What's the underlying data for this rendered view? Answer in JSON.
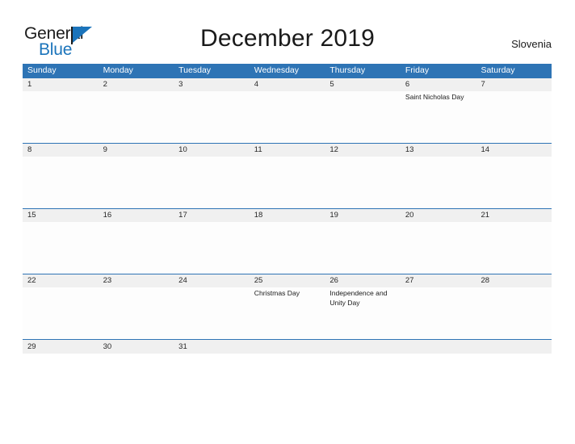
{
  "brand": {
    "name_part1": "General",
    "name_part2": "Blue",
    "flag_icon": "flag-triangle-icon"
  },
  "header": {
    "title": "December 2019",
    "country": "Slovenia"
  },
  "theme": {
    "header_blue": "#2e74b5",
    "logo_blue": "#1b74bb",
    "number_band": "#f0f0f0",
    "cell_bg": "#fdfdfd",
    "text": "#1a1a1a"
  },
  "calendar": {
    "weekdays": [
      "Sunday",
      "Monday",
      "Tuesday",
      "Wednesday",
      "Thursday",
      "Friday",
      "Saturday"
    ],
    "weeks": [
      {
        "height": "tall",
        "days": [
          {
            "num": "1",
            "event": ""
          },
          {
            "num": "2",
            "event": ""
          },
          {
            "num": "3",
            "event": ""
          },
          {
            "num": "4",
            "event": ""
          },
          {
            "num": "5",
            "event": ""
          },
          {
            "num": "6",
            "event": "Saint Nicholas Day"
          },
          {
            "num": "7",
            "event": ""
          }
        ]
      },
      {
        "height": "tall",
        "days": [
          {
            "num": "8",
            "event": ""
          },
          {
            "num": "9",
            "event": ""
          },
          {
            "num": "10",
            "event": ""
          },
          {
            "num": "11",
            "event": ""
          },
          {
            "num": "12",
            "event": ""
          },
          {
            "num": "13",
            "event": ""
          },
          {
            "num": "14",
            "event": ""
          }
        ]
      },
      {
        "height": "tall",
        "days": [
          {
            "num": "15",
            "event": ""
          },
          {
            "num": "16",
            "event": ""
          },
          {
            "num": "17",
            "event": ""
          },
          {
            "num": "18",
            "event": ""
          },
          {
            "num": "19",
            "event": ""
          },
          {
            "num": "20",
            "event": ""
          },
          {
            "num": "21",
            "event": ""
          }
        ]
      },
      {
        "height": "tall",
        "days": [
          {
            "num": "22",
            "event": ""
          },
          {
            "num": "23",
            "event": ""
          },
          {
            "num": "24",
            "event": ""
          },
          {
            "num": "25",
            "event": "Christmas Day"
          },
          {
            "num": "26",
            "event": "Independence and Unity Day"
          },
          {
            "num": "27",
            "event": ""
          },
          {
            "num": "28",
            "event": ""
          }
        ]
      },
      {
        "height": "short",
        "days": [
          {
            "num": "29",
            "event": ""
          },
          {
            "num": "30",
            "event": ""
          },
          {
            "num": "31",
            "event": ""
          },
          {
            "num": "",
            "event": ""
          },
          {
            "num": "",
            "event": ""
          },
          {
            "num": "",
            "event": ""
          },
          {
            "num": "",
            "event": ""
          }
        ]
      }
    ]
  }
}
